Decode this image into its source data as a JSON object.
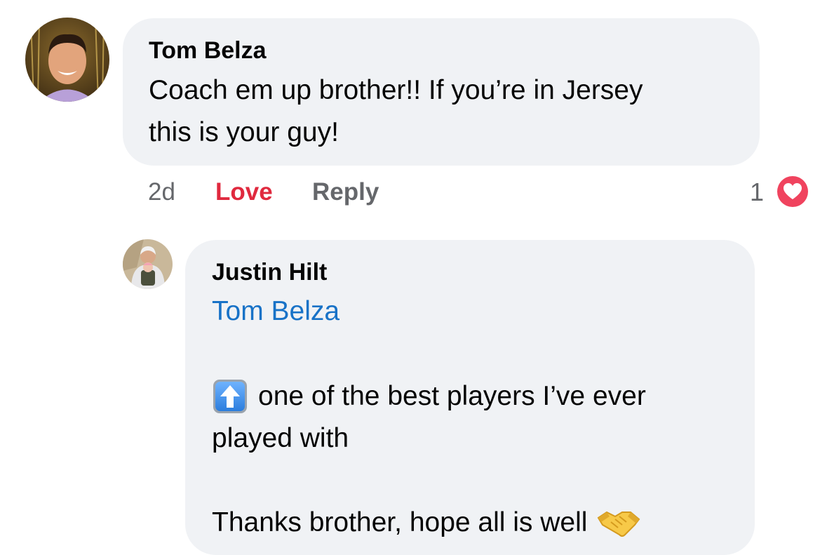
{
  "comment": {
    "author": "Tom Belza",
    "text_line1": "Coach em up brother!! If you’re in Jersey",
    "text_line2": "this is your guy!",
    "time": "2d",
    "love_label": "Love",
    "reply_label": "Reply",
    "reaction_count": "1",
    "reaction_icon": "heart-reaction-icon",
    "love_color": "#e0293e"
  },
  "reply": {
    "author": "Justin Hilt",
    "mention": "Tom Belza",
    "line1": "one of the best players I’ve ever",
    "line2": "played with",
    "line3": "Thanks brother, hope all is well",
    "emoji_1": "up-arrow-emoji",
    "emoji_2": "handshake-emoji",
    "mention_color": "#1872c7"
  },
  "colors": {
    "bubble_bg": "#f0f2f5",
    "secondary_text": "#65676b"
  }
}
